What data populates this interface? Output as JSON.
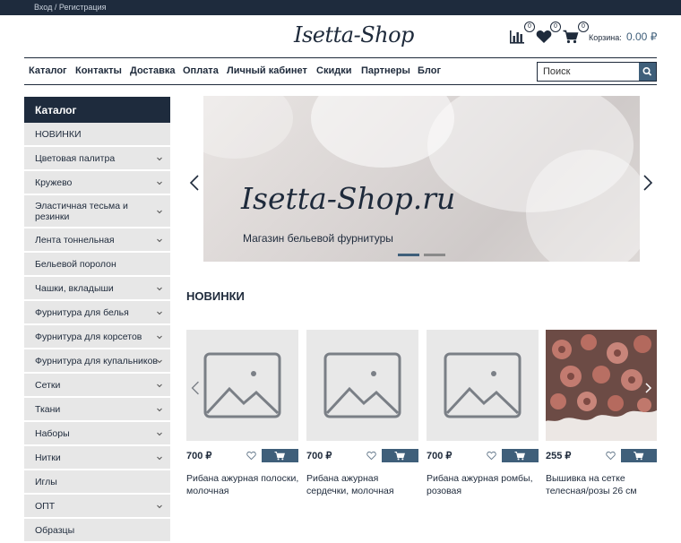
{
  "topbar": {
    "login_link": "Вход / Регистрация"
  },
  "header": {
    "logo": "Isetta-Shop",
    "compare_count": "0",
    "favorites_count": "0",
    "cart_count": "0",
    "cart_label": "Корзина:",
    "cart_total": "0.00 ₽"
  },
  "nav": {
    "items": [
      "Каталог",
      "Контакты",
      "Доставка",
      "Оплата",
      "Личный кабинет",
      "Скидки",
      "Партнеры",
      "Блог"
    ]
  },
  "search": {
    "placeholder": "Поиск"
  },
  "sidebar": {
    "title": "Каталог",
    "items": [
      "НОВИНКИ",
      "Цветовая палитра",
      "Кружево",
      "Эластичная тесьма и резинки",
      "Лента тоннельная",
      "Бельевой поролон",
      "Чашки, вкладыши",
      "Фурнитура для белья",
      "Фурнитура для корсетов",
      "Фурнитура для купальников",
      "Сетки",
      "Ткани",
      "Наборы",
      "Нитки",
      "Иглы",
      "ОПТ",
      "Образцы"
    ]
  },
  "banner": {
    "title": "Isetta-Shop.ru",
    "subtitle": "Магазин бельевой фурнитуры"
  },
  "section": {
    "title": "НОВИНКИ"
  },
  "products": [
    {
      "price": "700 ₽",
      "name": "Рибана ажурная полоски, молочная"
    },
    {
      "price": "700 ₽",
      "name": "Рибана ажурная сердечки, молочная"
    },
    {
      "price": "700 ₽",
      "name": "Рибана ажурная ромбы, розовая"
    },
    {
      "price": "255 ₽",
      "name": "Вышивка на сетке телесная/розы 26 см"
    }
  ],
  "colors": {
    "dark": "#1e2b3d",
    "accent": "#3f5f7a",
    "sidebar_bg": "#e7e7e7"
  }
}
